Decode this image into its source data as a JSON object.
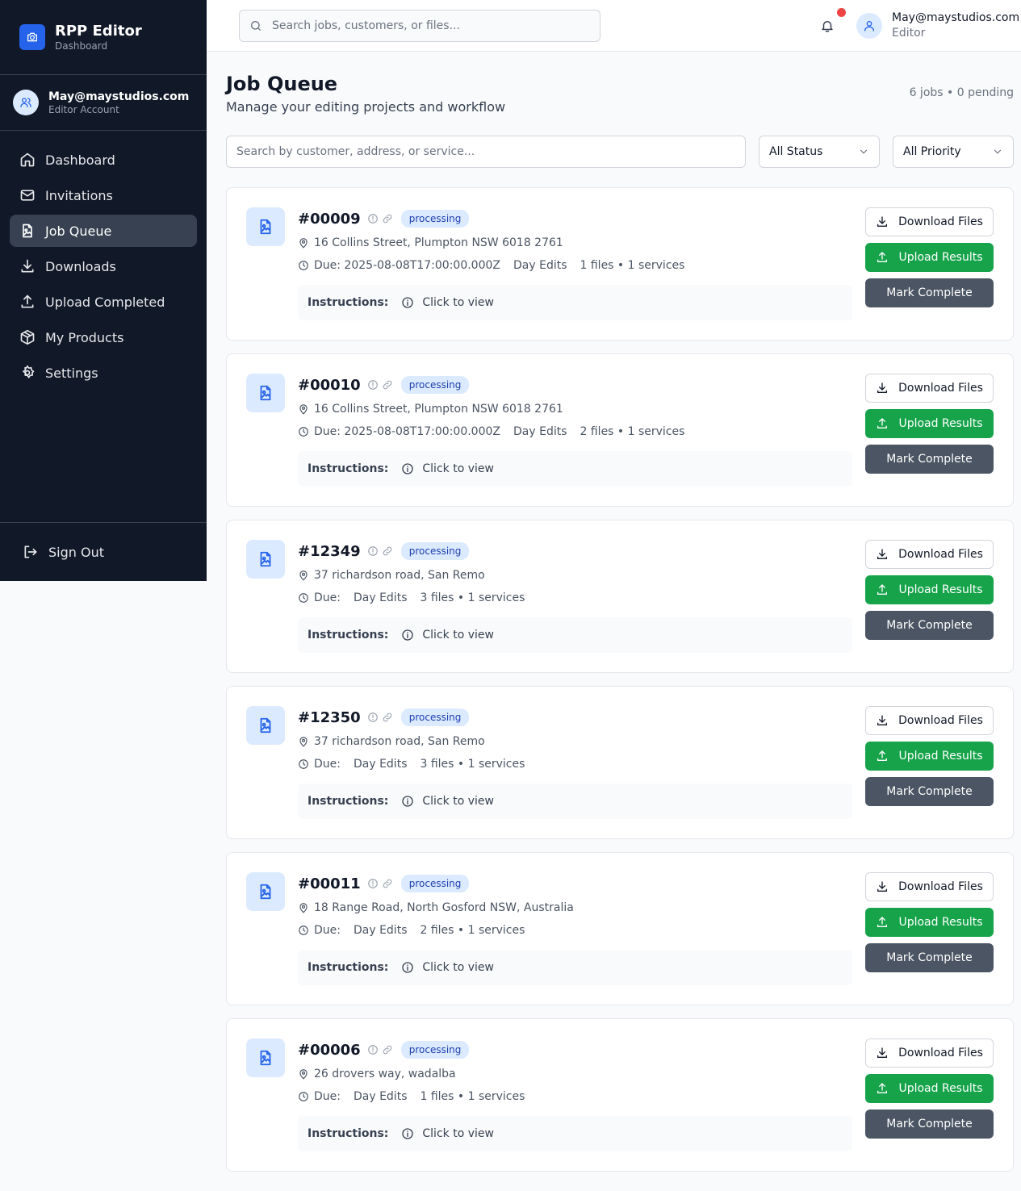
{
  "app": {
    "title": "RPP Editor",
    "subtitle": "Dashboard"
  },
  "account": {
    "email": "May@maystudios.com",
    "type": "Editor Account"
  },
  "sidebar": {
    "items": [
      {
        "label": "Dashboard",
        "icon": "home-icon",
        "active": false
      },
      {
        "label": "Invitations",
        "icon": "mail-icon",
        "active": false
      },
      {
        "label": "Job Queue",
        "icon": "file-image-icon",
        "active": true
      },
      {
        "label": "Downloads",
        "icon": "download-icon",
        "active": false
      },
      {
        "label": "Upload Completed",
        "icon": "upload-icon",
        "active": false
      },
      {
        "label": "My Products",
        "icon": "package-icon",
        "active": false
      },
      {
        "label": "Settings",
        "icon": "gear-icon",
        "active": false
      }
    ],
    "signout_label": "Sign Out"
  },
  "topbar": {
    "search_placeholder": "Search jobs, customers, or files...",
    "user_email": "May@maystudios.com",
    "user_role": "Editor",
    "notification_dot_color": "#ef4444"
  },
  "page": {
    "title": "Job Queue",
    "subtitle": "Manage your editing projects and workflow",
    "summary": "6 jobs • 0 pending"
  },
  "filters": {
    "search_placeholder": "Search by customer, address, or service...",
    "status_selected": "All Status",
    "priority_selected": "All Priority"
  },
  "labels": {
    "instructions": "Instructions:",
    "click_to_view": "Click to view",
    "download_files": "Download Files",
    "upload_results": "Upload Results",
    "mark_complete": "Mark Complete"
  },
  "colors": {
    "sidebar_bg": "#111827",
    "brand": "#2563eb",
    "upload_green": "#16a34a",
    "mark_complete_gray": "#4b5563",
    "badge_bg": "#dbeafe",
    "badge_text": "#1e40af"
  },
  "jobs": [
    {
      "id": "#00009",
      "status": "processing",
      "address": "16 Collins Street, Plumpton NSW 6018 2761",
      "due": "Due: 2025-08-08T17:00:00.000Z",
      "service": "Day Edits",
      "counts": "1 files • 1 services"
    },
    {
      "id": "#00010",
      "status": "processing",
      "address": "16 Collins Street, Plumpton NSW 6018 2761",
      "due": "Due: 2025-08-08T17:00:00.000Z",
      "service": "Day Edits",
      "counts": "2 files • 1 services"
    },
    {
      "id": "#12349",
      "status": "processing",
      "address": "37 richardson road, San Remo",
      "due": "Due:",
      "service": "Day Edits",
      "counts": "3 files • 1 services"
    },
    {
      "id": "#12350",
      "status": "processing",
      "address": "37 richardson road, San Remo",
      "due": "Due:",
      "service": "Day Edits",
      "counts": "3 files • 1 services"
    },
    {
      "id": "#00011",
      "status": "processing",
      "address": "18 Range Road, North Gosford NSW, Australia",
      "due": "Due:",
      "service": "Day Edits",
      "counts": "2 files • 1 services"
    },
    {
      "id": "#00006",
      "status": "processing",
      "address": "26 drovers way, wadalba",
      "due": "Due:",
      "service": "Day Edits",
      "counts": "1 files • 1 services"
    }
  ]
}
